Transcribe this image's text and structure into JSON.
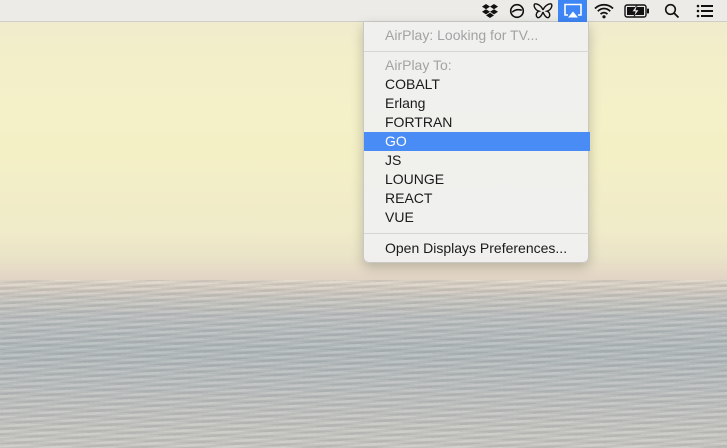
{
  "menubar": {
    "status_items": [
      {
        "name": "dropbox-icon"
      },
      {
        "name": "sync-icon"
      },
      {
        "name": "butterfly-icon"
      },
      {
        "name": "airplay-icon",
        "active": true
      },
      {
        "name": "wifi-icon"
      },
      {
        "name": "battery-charging-icon"
      },
      {
        "name": "search-icon"
      },
      {
        "name": "notification-center-icon"
      }
    ],
    "accent_color": "#3e86f5"
  },
  "airplay_menu": {
    "status": "AirPlay: Looking for TV...",
    "section_header": "AirPlay To:",
    "devices": [
      {
        "label": "COBALT",
        "selected": false
      },
      {
        "label": "Erlang",
        "selected": false
      },
      {
        "label": "FORTRAN",
        "selected": false
      },
      {
        "label": "GO",
        "selected": true
      },
      {
        "label": "JS",
        "selected": false
      },
      {
        "label": "LOUNGE",
        "selected": false
      },
      {
        "label": "REACT",
        "selected": false
      },
      {
        "label": "VUE",
        "selected": false
      }
    ],
    "open_prefs": "Open Displays Preferences...",
    "highlight_color": "#4a8cf6"
  }
}
